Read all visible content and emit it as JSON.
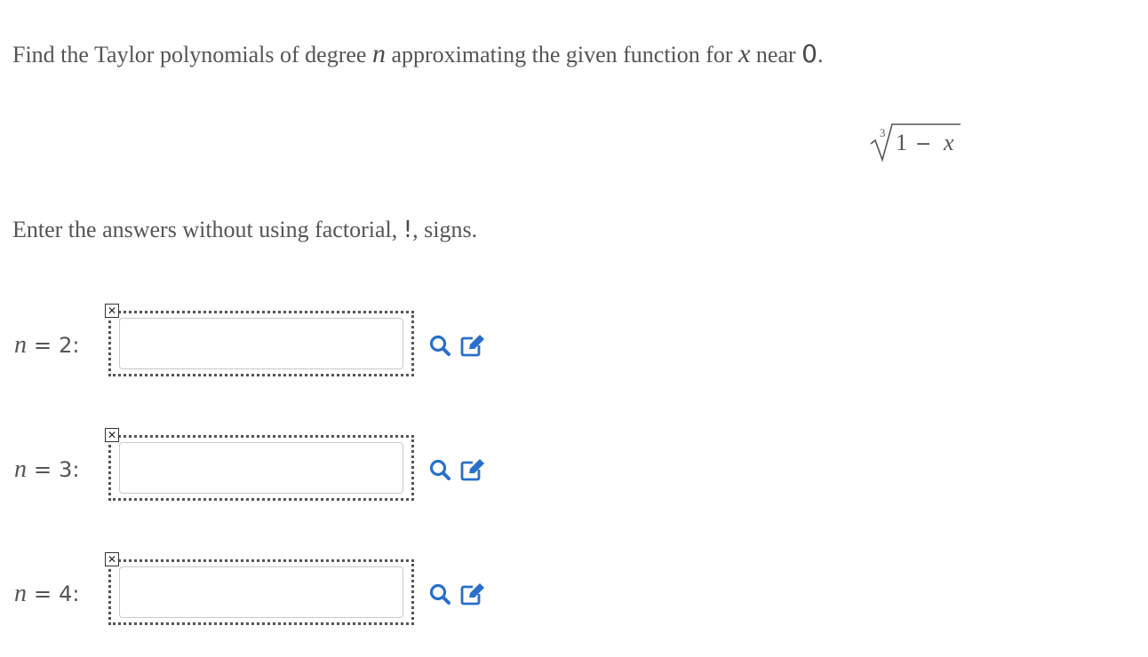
{
  "prompt": {
    "before_n": "Find the Taylor polynomials of degree ",
    "n_symbol": "n",
    "middle": " approximating the given function for ",
    "x_symbol": "x",
    "after_x": " near ",
    "point": "0",
    "end": "."
  },
  "formula": {
    "root_index": "3",
    "one": "1",
    "minus": "−",
    "x": "x"
  },
  "instruction": {
    "before": "Enter the answers without using factorial, ",
    "bang": "!",
    "after": ", signs."
  },
  "answers": [
    {
      "n_symbol": "n",
      "equals": "=",
      "value": "2:",
      "input_value": "",
      "clear_icon": "close-icon",
      "preview_icon": "magnifier-icon",
      "edit_icon": "pencil-square-icon"
    },
    {
      "n_symbol": "n",
      "equals": "=",
      "value": "3:",
      "input_value": "",
      "clear_icon": "close-icon",
      "preview_icon": "magnifier-icon",
      "edit_icon": "pencil-square-icon"
    },
    {
      "n_symbol": "n",
      "equals": "=",
      "value": "4:",
      "input_value": "",
      "clear_icon": "close-icon",
      "preview_icon": "magnifier-icon",
      "edit_icon": "pencil-square-icon"
    }
  ],
  "colors": {
    "text": "#555555",
    "icon_blue": "#2a6fcb",
    "frame": "#555555"
  }
}
